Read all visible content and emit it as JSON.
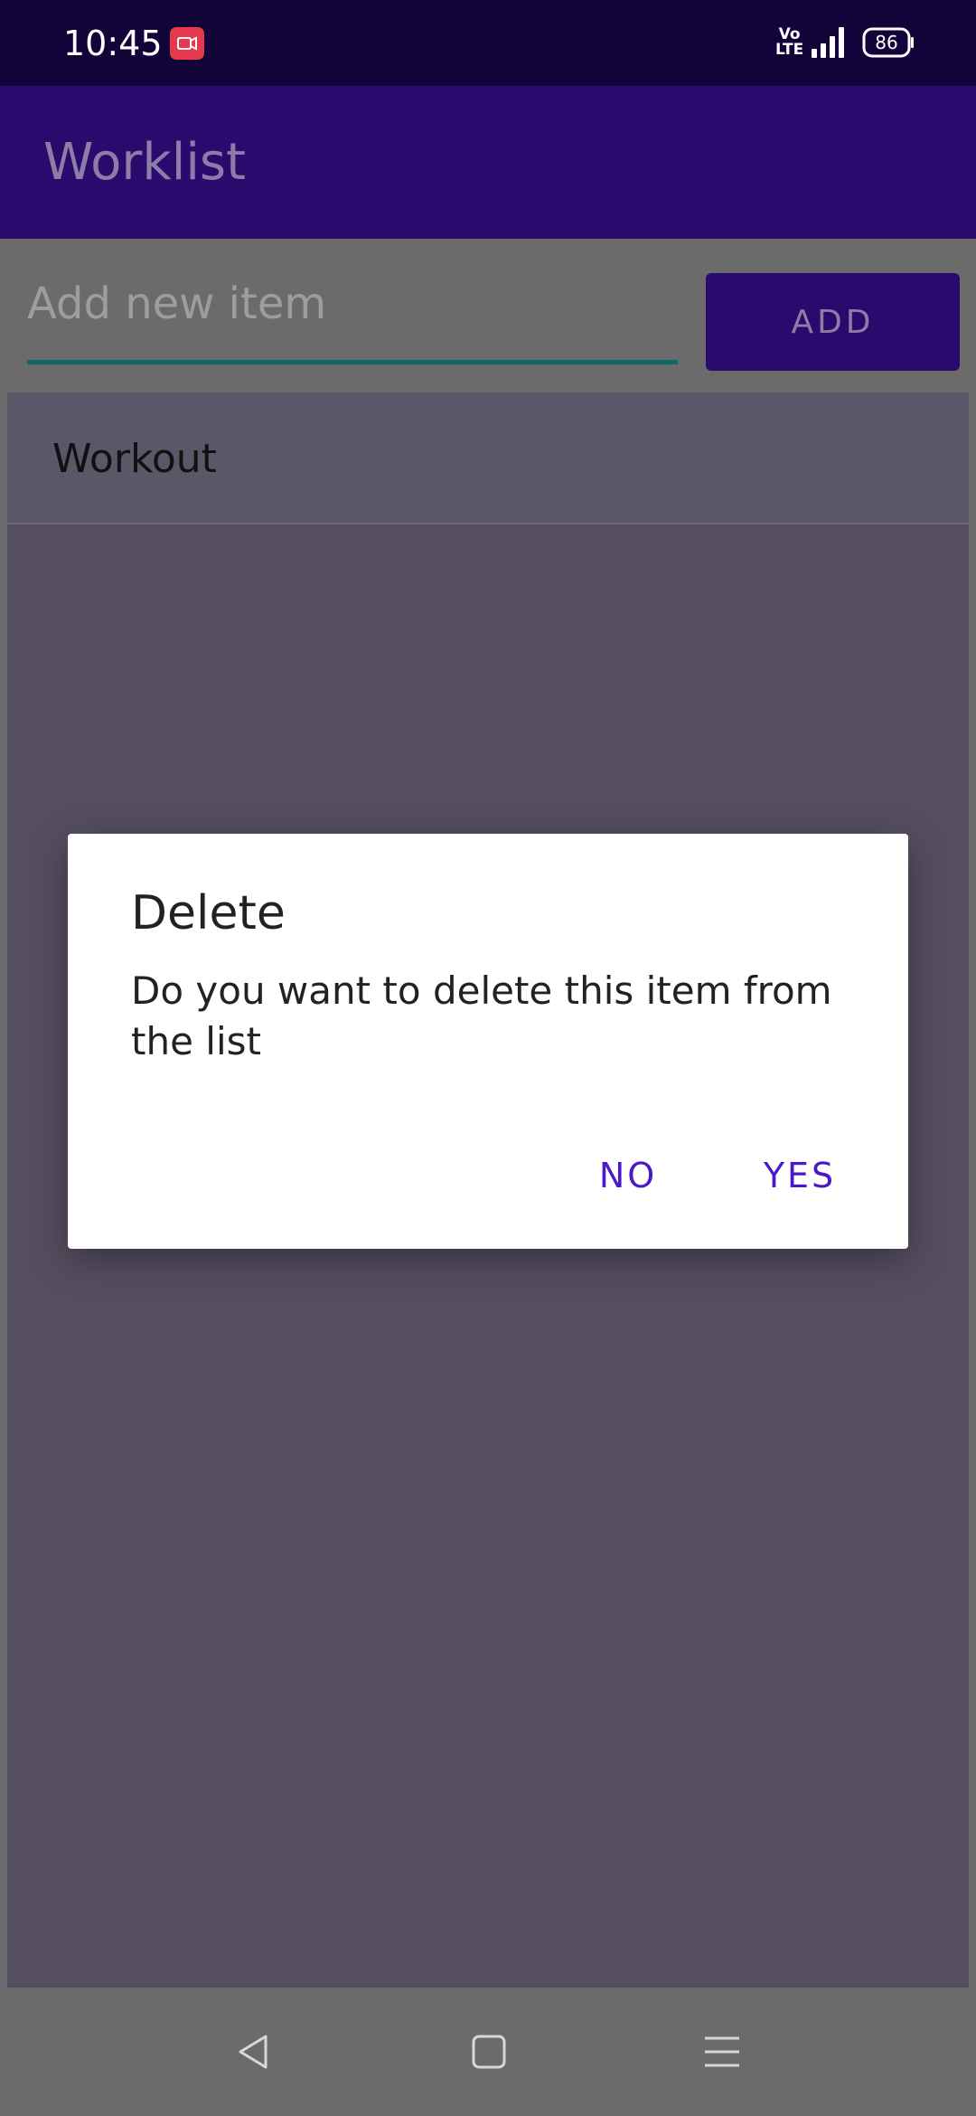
{
  "status_bar": {
    "time": "10:45",
    "network_top": "Vo",
    "network_bottom": "LTE",
    "battery": "86",
    "icons": [
      "screen-record-icon",
      "volte-icon",
      "signal-icon",
      "battery-icon"
    ]
  },
  "app_bar": {
    "title": "Worklist"
  },
  "input_row": {
    "placeholder": "Add new item",
    "value": "",
    "add_label": "ADD"
  },
  "list": {
    "items": [
      {
        "label": "Workout"
      }
    ]
  },
  "dialog": {
    "title": "Delete",
    "message": "Do you want to delete this item from the list",
    "no_label": "NO",
    "yes_label": "YES"
  },
  "nav_bar": {
    "icons": [
      "back-icon",
      "home-icon",
      "menu-icon"
    ]
  },
  "colors": {
    "status_bar": "#120438",
    "app_bar": "#2a0a6c",
    "accent_text": "#4a17c9",
    "underline": "#0d6a63",
    "record_badge": "#e53950"
  }
}
